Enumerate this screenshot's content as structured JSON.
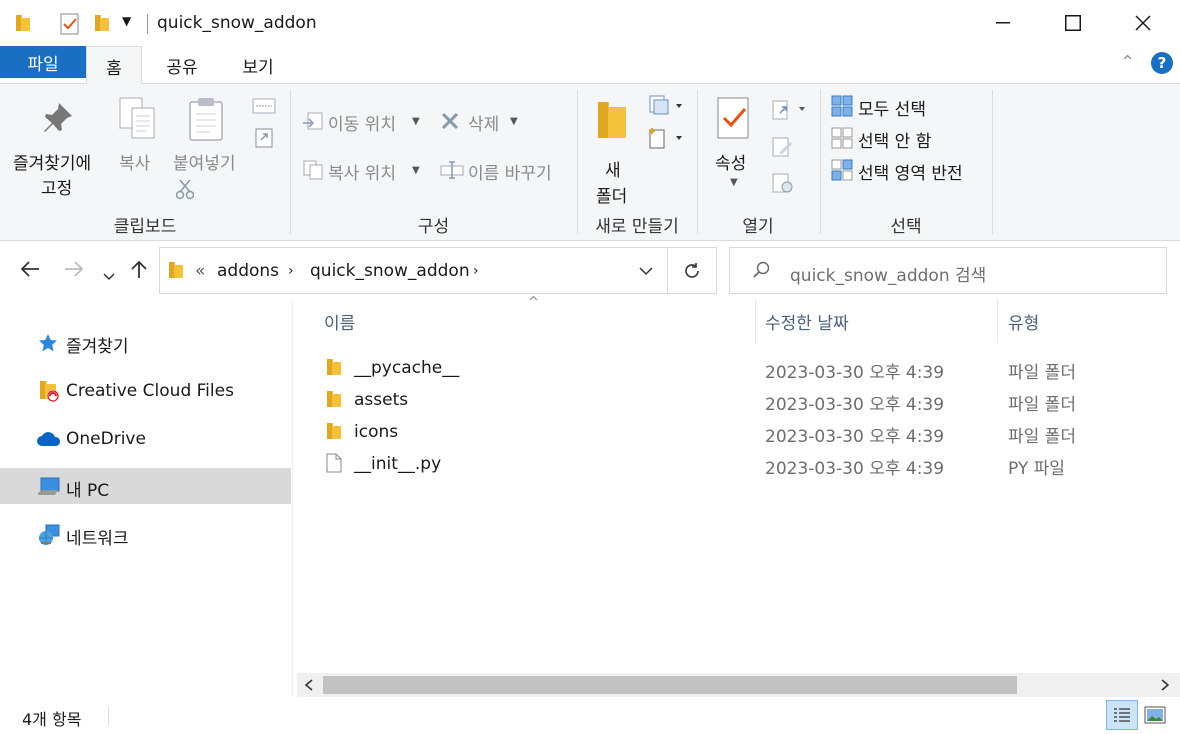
{
  "window": {
    "title": "quick_snow_addon",
    "minimize": "—",
    "maximize": "☐",
    "close": "✕"
  },
  "ribbon_tabs": [
    "파일",
    "홈",
    "공유",
    "보기"
  ],
  "ribbon": {
    "clipboard": {
      "pin_line1": "즐겨찾기에",
      "pin_line2": "고정",
      "copy": "복사",
      "paste": "붙여넣기",
      "label": "클립보드"
    },
    "organize": {
      "move_to": "이동 위치",
      "copy_to": "복사 위치",
      "delete": "삭제",
      "rename": "이름 바꾸기",
      "label": "구성"
    },
    "new": {
      "new_folder_line1": "새",
      "new_folder_line2": "폴더",
      "label": "새로 만들기"
    },
    "open": {
      "properties": "속성",
      "label": "열기"
    },
    "select": {
      "select_all": "모두 선택",
      "select_none": "선택 안 함",
      "invert": "선택 영역 반전",
      "label": "선택"
    }
  },
  "address": {
    "overflow": "«",
    "crumbs": [
      "addons",
      "quick_snow_addon"
    ],
    "search_placeholder": "quick_snow_addon 검색"
  },
  "sidebar": {
    "items": [
      {
        "label": "즐겨찾기",
        "icon": "star-icon"
      },
      {
        "label": "Creative Cloud Files",
        "icon": "creative-cloud-folder-icon"
      },
      {
        "label": "OneDrive",
        "icon": "onedrive-cloud-icon"
      },
      {
        "label": "내 PC",
        "icon": "computer-icon",
        "selected": true
      },
      {
        "label": "네트워크",
        "icon": "network-icon"
      }
    ]
  },
  "columns": {
    "name": "이름",
    "date": "수정한 날짜",
    "type": "유형"
  },
  "files": [
    {
      "name": "__pycache__",
      "date": "2023-03-30 오후 4:39",
      "type": "파일 폴더",
      "icon": "folder-icon"
    },
    {
      "name": "assets",
      "date": "2023-03-30 오후 4:39",
      "type": "파일 폴더",
      "icon": "folder-icon"
    },
    {
      "name": "icons",
      "date": "2023-03-30 오후 4:39",
      "type": "파일 폴더",
      "icon": "folder-icon"
    },
    {
      "name": "__init__.py",
      "date": "2023-03-30 오후 4:39",
      "type": "PY 파일",
      "icon": "file-icon"
    }
  ],
  "status": {
    "item_count": "4개 항목"
  },
  "colors": {
    "file_tab": "#1a6fc0",
    "folder": "#f3c13a",
    "accent": "#0a64c8"
  }
}
